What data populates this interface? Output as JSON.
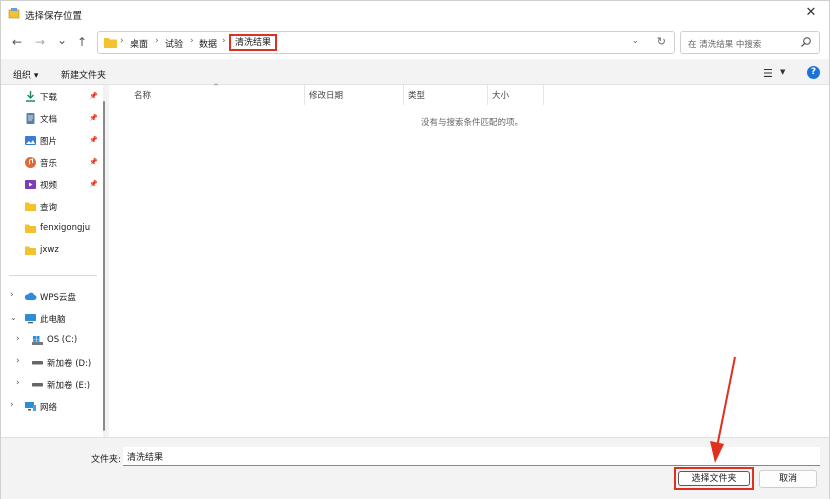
{
  "window": {
    "title": "选择保存位置",
    "close_glyph": "✕"
  },
  "nav": {
    "back_glyph": "←",
    "forward_glyph": "→",
    "recent_glyph": "⌄",
    "up_glyph": "↑",
    "breadcrumbs": [
      "桌面",
      "试验",
      "数据"
    ],
    "current_folder": "清洗结果",
    "dropdown_glyph": "⌄",
    "refresh_glyph": "↻"
  },
  "search": {
    "placeholder": "在 清洗结果 中搜索"
  },
  "toolbar": {
    "organize": "组织 ▾",
    "new_folder": "新建文件夹",
    "help": "?"
  },
  "sidebar": {
    "quick_access": [
      {
        "label": "下载",
        "icon": "download-icon"
      },
      {
        "label": "文档",
        "icon": "document-icon"
      },
      {
        "label": "图片",
        "icon": "picture-icon"
      },
      {
        "label": "音乐",
        "icon": "music-icon"
      },
      {
        "label": "视频",
        "icon": "video-icon"
      },
      {
        "label": "查询",
        "icon": "folder-icon"
      },
      {
        "label": "fenxigongju",
        "icon": "folder-icon"
      },
      {
        "label": "jxwz",
        "icon": "folder-icon"
      }
    ],
    "tree": [
      {
        "label": "WPS云盘",
        "icon": "cloud-icon"
      },
      {
        "label": "此电脑",
        "icon": "computer-icon"
      },
      {
        "label": "OS (C:)",
        "icon": "windows-drive-icon"
      },
      {
        "label": "新加卷 (D:)",
        "icon": "drive-icon"
      },
      {
        "label": "新加卷 (E:)",
        "icon": "drive-icon"
      },
      {
        "label": "网络",
        "icon": "network-icon"
      }
    ]
  },
  "columns": {
    "name": "名称",
    "modified": "修改日期",
    "type": "类型",
    "size": "大小"
  },
  "empty_message": "没有与搜索条件匹配的项。",
  "footer": {
    "folder_label": "文件夹:",
    "folder_value": "清洗结果",
    "select_button": "选择文件夹",
    "cancel_button": "取消"
  },
  "colors": {
    "highlight": "#e0301e",
    "accent": "#1a73d9",
    "folder": "#f2c230"
  }
}
